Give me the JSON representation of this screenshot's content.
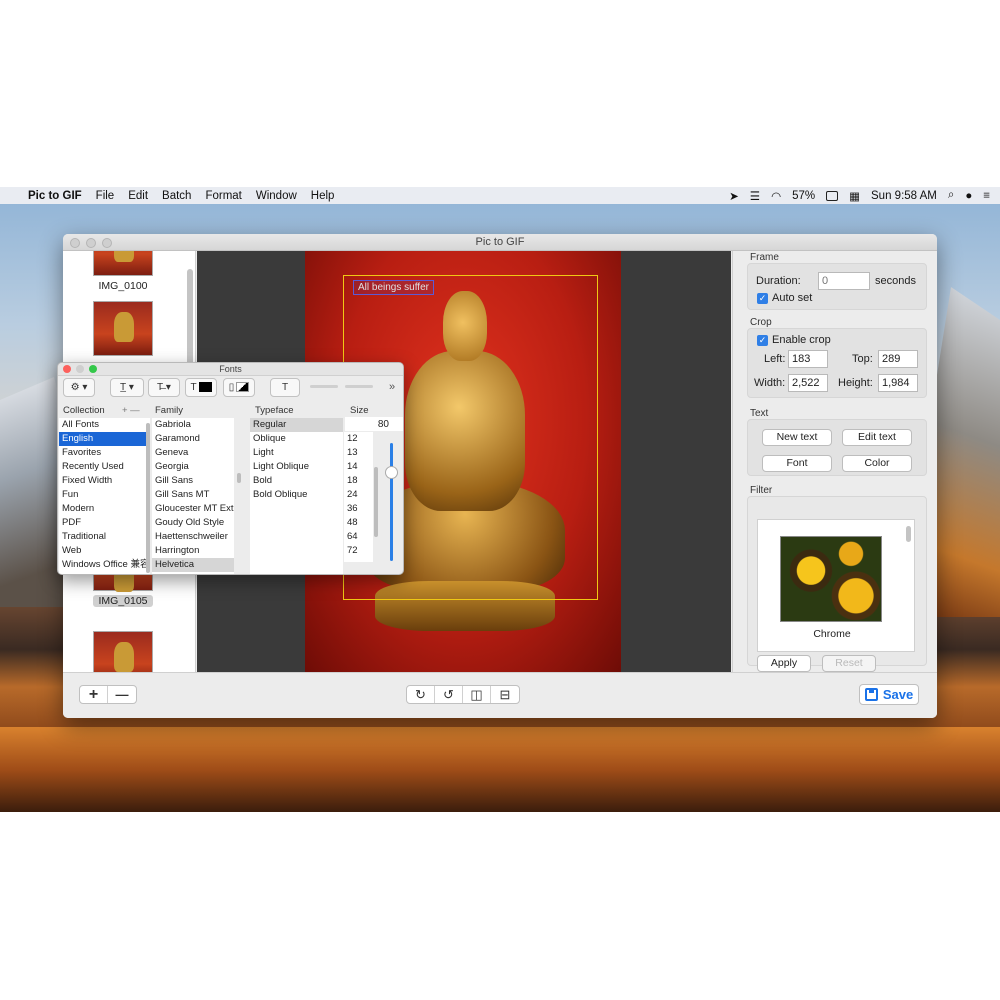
{
  "menubar": {
    "app_name": "Pic to GIF",
    "items": [
      "File",
      "Edit",
      "Batch",
      "Format",
      "Window",
      "Help"
    ],
    "battery": "57%",
    "clock": "Sun 9:58 AM"
  },
  "window": {
    "title": "Pic to GIF"
  },
  "thumbnails": [
    {
      "label": "IMG_0100"
    },
    {
      "label": "IMG_0105"
    }
  ],
  "canvas": {
    "overlay_text": "All beings suffer"
  },
  "side": {
    "frame": {
      "title": "Frame",
      "duration_label": "Duration:",
      "duration_placeholder": "0",
      "seconds_label": "seconds",
      "auto_set_label": "Auto set"
    },
    "crop": {
      "title": "Crop",
      "enable_label": "Enable crop",
      "left_label": "Left:",
      "left_value": "183",
      "top_label": "Top:",
      "top_value": "289",
      "width_label": "Width:",
      "width_value": "2,522",
      "height_label": "Height:",
      "height_value": "1,984"
    },
    "text": {
      "title": "Text",
      "new_text": "New text",
      "edit_text": "Edit text",
      "font": "Font",
      "color": "Color"
    },
    "filter": {
      "title": "Filter",
      "name": "Chrome",
      "apply": "Apply",
      "reset": "Reset"
    }
  },
  "bottombar": {
    "add": "+",
    "remove": "—",
    "save": "Save"
  },
  "fonts_panel": {
    "title": "Fonts",
    "collection_header": "Collection",
    "family_header": "Family",
    "typeface_header": "Typeface",
    "size_header": "Size",
    "size_value": "80",
    "collections": [
      "All Fonts",
      "English",
      "Favorites",
      "Recently Used",
      "Fixed Width",
      "Fun",
      "Modern",
      "PDF",
      "Traditional",
      "Web",
      "Windows Office 兼容"
    ],
    "families": [
      "Gabriola",
      "Garamond",
      "Geneva",
      "Georgia",
      "Gill Sans",
      "Gill Sans MT",
      "Gloucester MT Extr",
      "Goudy Old Style",
      "Haettenschweiler",
      "Harrington",
      "Helvetica"
    ],
    "typefaces": [
      "Regular",
      "Oblique",
      "Light",
      "Light Oblique",
      "Bold",
      "Bold Oblique"
    ],
    "sizes": [
      "12",
      "13",
      "14",
      "18",
      "24",
      "36",
      "48",
      "64",
      "72"
    ]
  }
}
